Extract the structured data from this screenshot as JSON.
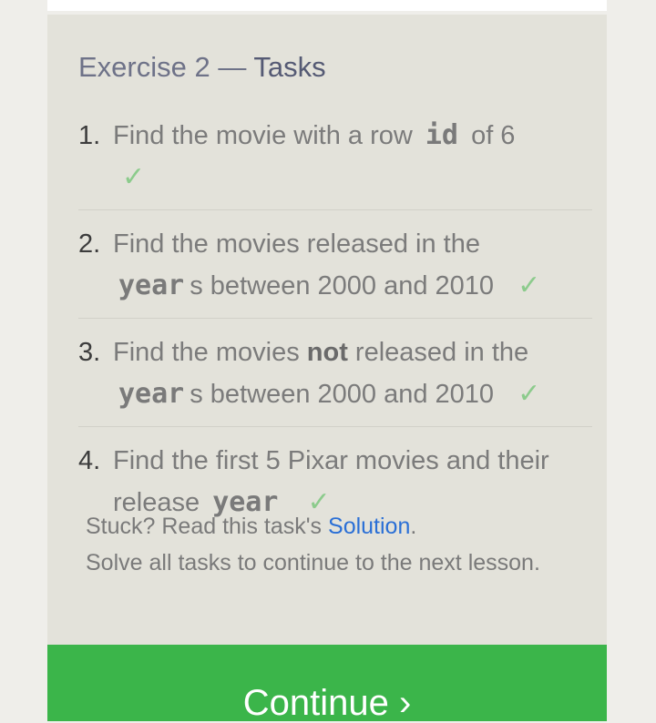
{
  "exercise": {
    "title_prefix": "Exercise 2",
    "title_dash": "—",
    "title_suffix": "Tasks"
  },
  "tasks": [
    {
      "number": "1.",
      "text_before": "Find the movie with a row",
      "code": "id",
      "text_after": "of 6",
      "check": "✓"
    },
    {
      "number": "2.",
      "text_before": "Find the movies released in the",
      "code": "year",
      "text_after": "s between 2000 and 2010",
      "check": "✓"
    },
    {
      "number": "3.",
      "text_before": "Find the movies",
      "bold": "not",
      "text_mid": "released in the",
      "code": "year",
      "text_after": "s between 2000 and 2010",
      "check": "✓"
    },
    {
      "number": "4.",
      "text_before": "Find the first 5 Pixar movies and their release",
      "code": "year",
      "check": "✓"
    }
  ],
  "help": {
    "stuck_text": "Stuck? Read this task's",
    "solution_link": "Solution",
    "period": ".",
    "continue_note": "Solve all tasks to continue to the next lesson."
  },
  "continue_button": {
    "label": "Continue",
    "arrow": "›"
  },
  "colors": {
    "panel_bg": "#e3e2da",
    "check_green": "#8ccb8c",
    "button_green": "#3bb54a",
    "link_blue": "#2a6fd6"
  }
}
